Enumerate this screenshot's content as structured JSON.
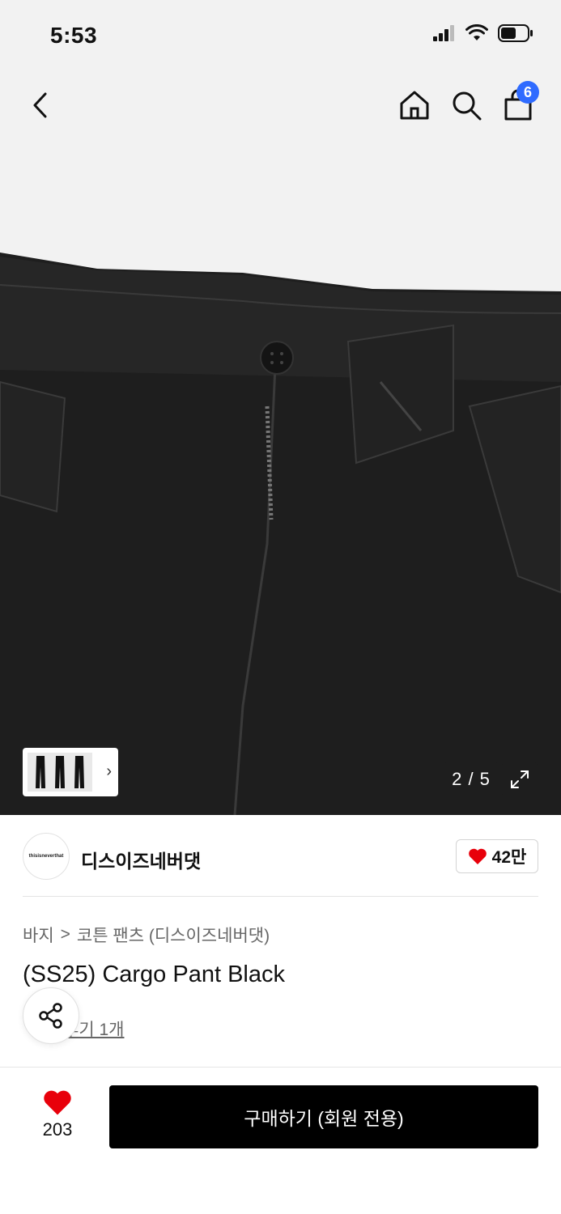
{
  "status_bar": {
    "time": "5:53"
  },
  "nav": {
    "cart_count": "6"
  },
  "image": {
    "page_indicator": "2 / 5"
  },
  "brand": {
    "logo_text": "thisisneverthat",
    "name": "디스이즈네버댓",
    "likes": "42만"
  },
  "breadcrumb": {
    "category": "바지",
    "separator": ">",
    "subcategory": "코튼 팬츠 (디스이즈네버댓)"
  },
  "product": {
    "title": "(SS25) Cargo Pant Black",
    "review_text": "후기 1개"
  },
  "bottom": {
    "wish_count": "203",
    "buy_label": "구매하기 (회원 전용)"
  },
  "colors": {
    "badge": "#2f6bff",
    "heart": "#e8000b",
    "buy_button": "#000000"
  }
}
